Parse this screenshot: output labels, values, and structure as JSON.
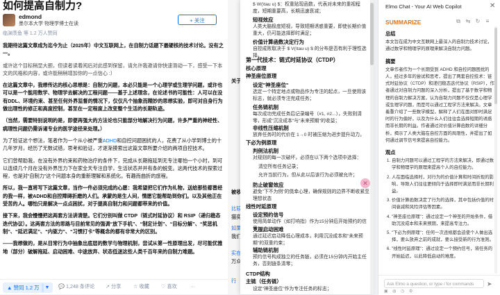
{
  "question": {
    "title": "如何提高自制力?"
  },
  "author": {
    "name": "edmond",
    "bio": "墨尔本大学 物理学博士在读",
    "follow": "+ 关注"
  },
  "answer_stats": "临渊羡鱼 等 1.2 万人赞同",
  "article": {
    "p1": "我期待这篇文章成为迄今为止（2025年）中文互联网上，在自制力话题下最硬核的技术讨论。没有之一。",
    "p2": "或许这个目标稍显大胆，但读者读着阅后对此感到保留，请允许我邀请你快速滑动一下，感受一下本文的风格和内容，或许能稍稍增加你的一点信心 :）",
    "p3": "在这篇文章中，我想传达的核心思想是：自制力问题，本必只能是一个心理学或生理学问题，或许也可以是一个能用数学、物理学去解决的工程问题——基于上述理念，在论述书的可能性：人可以在没有DDL、环境约束、甚至任何外界监督的情况下，仅仅凡个抽象而精妙的思想实验，即可对自身行为做出理性的修正和高度控制，甚至在一定程度上改变整个生活的长期轨迹。",
    "p4": "（当然，需要特别说明的是，即便再强大的方法论也只能部分地解决行为问题，许多严重的神经性、病理性问题仍需诉诸专业的医学途径来处理。）",
    "p5a": "为了验证这个想法，笔者作为一个从小被严重",
    "p5link": "ADHD",
    "p5b": "和自控问题困扰的人，花费了从小学到博士的十几年岁月，经历了无数试错，思考和验证，才逐渐摸索出这篇文章所要介绍的两项自控技术。",
    "p6": "它们曾帮助我，在没有外界约束和药物治疗的条件下，完成从长期拖延到无专注哪怕一个小时，到可以连续几个月在没有外界压力下在家全天专注自学，生活状态并并有条的蜕变。这两代技术的探索过程，也是对“自制力”这个问题本身的重新理解和系统化。有趣而曲折的旅程。",
    "p7": "所以，我一直将写下这篇文章，当作一件必须完成的心愿：我希望把它们作为礼物，送给那些都曾经的我一样，被ADHD和自控障碍折磨的人们。承蒙的是生人间，情愿它能帮助到你们。以及其他正在受苦的人。哪怕只是解决一点点困扰，对于提高自制力和问题都带来的价值。",
    "p8": "接下来，我会慢慢把这两套方法讲清楚。它们分别叫做 CTDP（链式时延协议）和 RSIP（递归稳态迭代协议）。这两套方法的思路与目前常见的强调“放下手机”、“制定计划”、“目标分解”、“奖惩机制”、“延迟满足”、“内驱力”、“习惯打卡”等概念的都有非常大的区别。",
    "p9": "——我想做的，是从目常行为中抽象出底层的数学与物理机制，尝试从第一性原理出发，尽可能优雅地（部分）破解拖延、启动困难、中途放弃、状态低迷这些人类千百年来的自制力难题。"
  },
  "vote_bar": {
    "upvote": "▲ 赞同 1.2 万",
    "downvote": "▼",
    "comments": "💬 1,248 条评论",
    "share": "↗ 分享",
    "collect": "☆ 收藏",
    "like": "♡ 喜欢",
    "more": "···"
  },
  "middle": {
    "c1": "关于",
    "c2": "被收",
    "c3": "比较",
    "c4": "猫奕",
    "c5": "如果",
    "c6": "我们",
    "c7": "实在",
    "c8": "万众",
    "c9": "行"
  },
  "popup": {
    "l1": "$ W(\\tau u) $：权重贴现函数，代表对未来的重视程度，短期重要高，长期迅速衰减；",
    "h1": "短视效应",
    "l2": "人类大脑极度短视，导致短期诱惑重要，即使长期价值重大，仍可能选择即时满足；",
    "h2": "价值计算函数决定行为",
    "l3": "自控成败取决于 $ V(\\tau u) $ 的分布是否有利于理性选择。",
    "sec1": "第一代技术：链式时延协议（CTDP）",
    "h3": "核心原理",
    "h4": "神圣座位原理",
    "s1h": "设定\"神圣座位\"",
    "s1": "选定一个特定地点或物品作为专注的起点，一旦使用该标志，就必须专注完成任务；",
    "s2h": "任务链机制",
    "s2": "每次成功完成任务后记录编号（#1, #2...），失败则清零，形成\"沉没成本\"与\"未来预期\"的收益；",
    "s3h": "非线性压缩机制",
    "s3": "放弃任务时的代价在 1→0 时被压缩为进步提升动力。",
    "h5": "下必为例原理",
    "s4h": "判例法机制",
    "s4": "对规则的每一次破坏，必须在以下两个选项中选择：",
    "s4a": "清空所有任务记录；",
    "s4b": "允许当前行为，但从此以后该行为必须被允许；",
    "s5h": "防止破窗效应",
    "s5": "避免\"下不为例\"的侥幸心理，确保规则的边界不断收紧至理想状态",
    "h6": "线性时延原理",
    "s6h": "设定预约信号",
    "s6": "使用简单动作（如打响指）作为15分钟后开始预约的信号；",
    "s7h": "克服启动困难",
    "s7": "通过延迟启动降低心理成本，利用沉没成本和\"未来预期\"的双重约束；",
    "s8h": "辅助链机制",
    "s8": "预约信号构成独立的任务链，必须在15分钟内开始主任务，否则链条清零；",
    "h7": "CTDP结构",
    "h8": "主链（任务链）",
    "s9": "设定\"神圣座位\"作为专注任务的标志；"
  },
  "panel": {
    "title": "Elmo Chat - Your AI Web Copilot",
    "close": "✕",
    "summarize": "SUMMARIZE",
    "h_summary": "总结",
    "summary": "本文旨在成为中文互联网上最深入的自制力技术讨论，通过数学和物理学的原理来解决自制力问题。",
    "h_abstract": "摘要",
    "abstract": "文章作者作为一个长期受到 ADHD 和自控问题困扰的人，经过多年的尝试和思考，提出了两套自控技术：链式时延协议（CTDP）和递归稳态迭代协议（RSIP），作者通过对自制力问题的深入分析，提出了基于数学和物理的自制力解决方案，认为自制力问题不仅仅是心理学或生理学问题，而是可以通过工程学方法来解决。文章着重介绍了一些数学模型，解释了人们在面对即时满足时的行为偏好，以及为什么人们往往会选择短期的诱惑而非长期的利益。作者通过对价值计算函数的详细分析，揭示了人类大脑在自控方面的局限性，并提出了如何通过调节信号来提高自控能力。",
    "h_points": "观点",
    "points": [
      "自制力问题可以通过工程学的方法来解决，即通过数学和物理学的原理来提高个人的自控能力。",
      "人在面临选择时，对行为的价值计算和时间折现的影响，导致人们往往更倾向于选择即时满足而非长期利益。",
      "价值计算函数决定了行为的选择，其中包括价值的时间衰减和风险评估等因素。",
      "\"神圣座位原理\"：通过设定一个神圣的开始条件，借助沉没成本和未来预期，来提高专注力。",
      "\"下必为例原理\"：任何一次违规都会迫使个人做出选择，要么放弃之前的成就，要么接受新的行为准则。",
      "\"线性时延原理\"：通过设定一个预约信号，将任务的开始延迟，以此降低启动的难度。"
    ],
    "ask_placeholder": "Ask Elmo a question, or type / for commands",
    "send": "➤"
  },
  "colors": {
    "accent_blue": "#1772f6",
    "summarize_orange": "#e2741d",
    "popup_pink": "#f3b5cc"
  }
}
